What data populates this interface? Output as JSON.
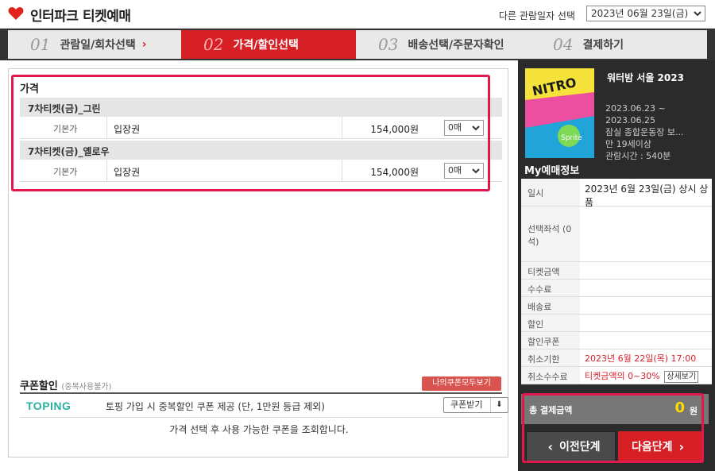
{
  "header": {
    "logo_text": "인터파크 티켓예매",
    "date_label": "다른 관람일자 선택",
    "date_selected": "2023년 06월 23일(금)"
  },
  "steps": [
    {
      "num": "01",
      "label": "관람일/회차선택"
    },
    {
      "num": "02",
      "label": "가격/할인선택"
    },
    {
      "num": "03",
      "label": "배송선택/주문자확인"
    },
    {
      "num": "04",
      "label": "결제하기"
    }
  ],
  "price": {
    "section_title": "가격",
    "grades": [
      {
        "name": "7차티켓(금)_그린",
        "type": "기본가",
        "ticket": "입장권",
        "amount": "154,000원",
        "qty": "0매"
      },
      {
        "name": "7차티켓(금)_옐로우",
        "type": "기본가",
        "ticket": "입장권",
        "amount": "154,000원",
        "qty": "0매"
      }
    ]
  },
  "coupon": {
    "title": "쿠폰할인",
    "subtitle": "(중복사용불가)",
    "my_coupons_label": "나의쿠폰모두보기",
    "toping_logo": "TOPING",
    "toping_desc": "토핑 가입 시 중복할인 쿠폰 제공 (단, 1만원 등급 제외)",
    "get_label": "쿠폰받기",
    "notice": "가격 선택 후 사용 가능한 쿠폰을 조회합니다."
  },
  "show": {
    "title": "워터밤 서울 2023",
    "dates": [
      "2023.06.23 ~",
      "2023.06.25"
    ],
    "venue": "잠실 종합운동장 보...",
    "age": "만 19세이상",
    "runtime": "관람시간 : 540분"
  },
  "mybooking": {
    "title": "My예매정보",
    "rows": [
      {
        "k": "일시",
        "v": "2023년 6월 23일(금) 상시 상품"
      },
      {
        "k": "선택좌석 (0석)",
        "v": ""
      },
      {
        "k": "티켓금액",
        "v": ""
      },
      {
        "k": "수수료",
        "v": ""
      },
      {
        "k": "배송료",
        "v": ""
      },
      {
        "k": "할인",
        "v": ""
      },
      {
        "k": "할인쿠폰",
        "v": ""
      },
      {
        "k": "취소기한",
        "v": "2023년 6월 22일(목) 17:00"
      },
      {
        "k": "취소수수료",
        "v": "티켓금액의 0~30%",
        "detail": "상세보기"
      }
    ],
    "total_label": "총 결제금액",
    "total_amount": "0",
    "total_unit": "원"
  },
  "buttons": {
    "prev": "이전단계",
    "next": "다음단계"
  }
}
